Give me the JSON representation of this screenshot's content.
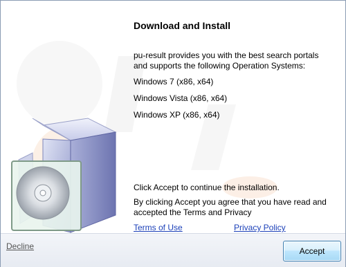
{
  "dialog": {
    "title": "Download and Install",
    "description": "pu-result provides you with the best search portals and supports the following Operation Systems:",
    "os_list": [
      "Windows 7 (x86, x64)",
      "Windows Vista (x86, x64)",
      "Windows XP (x86, x64)"
    ],
    "click_accept_text": "Click Accept to continue the installation.",
    "agreement_text": "By clicking Accept you agree that you have read and accepted the Terms and Privacy",
    "terms_link": "Terms of Use",
    "privacy_link": "Privacy Policy"
  },
  "footer": {
    "decline_label": "Decline",
    "accept_label": "Accept"
  },
  "icons": {
    "installer_art": "software-box-with-cd-icon",
    "watermark": "logo-watermark"
  },
  "colors": {
    "link": "#1a3fb8",
    "button_border": "#3c7fb1",
    "footer_bg": "#eef1f6"
  }
}
